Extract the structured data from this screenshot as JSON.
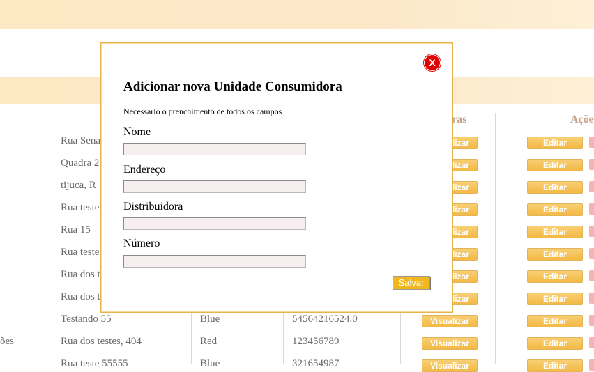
{
  "table": {
    "headers": {
      "col2_partial": "",
      "faturas_partial": "ras",
      "acoes_partial": "Açõe"
    },
    "left_edge_text": "ões",
    "rows": [
      {
        "endereco": "Rua Sena",
        "distribuidora": "",
        "numero": "",
        "visualizar": "Visualizar",
        "editar": "Editar"
      },
      {
        "endereco": "Quadra 2",
        "distribuidora": "",
        "numero": "",
        "visualizar": "Visualizar",
        "editar": "Editar"
      },
      {
        "endereco": "tijuca, R",
        "distribuidora": "",
        "numero": "",
        "visualizar": "Visualizar",
        "editar": "Editar"
      },
      {
        "endereco": "Rua teste",
        "distribuidora": "",
        "numero": "",
        "visualizar": "Visualizar",
        "editar": "Editar"
      },
      {
        "endereco": "Rua 15",
        "distribuidora": "",
        "numero": "",
        "visualizar": "Visualizar",
        "editar": "Editar"
      },
      {
        "endereco": "Rua teste",
        "distribuidora": "",
        "numero": "",
        "visualizar": "Visualizar",
        "editar": "Editar"
      },
      {
        "endereco": "Rua dos t",
        "distribuidora": "",
        "numero": "",
        "visualizar": "Visualizar",
        "editar": "Editar"
      },
      {
        "endereco": "Rua dos t",
        "distribuidora": "",
        "numero": "",
        "visualizar": "Visualizar",
        "editar": "Editar"
      },
      {
        "endereco": "Testando 55",
        "distribuidora": "Blue",
        "numero": "54564216524.0",
        "visualizar": "Visualizar",
        "editar": "Editar"
      },
      {
        "endereco": "Rua dos testes, 404",
        "distribuidora": "Red",
        "numero": "123456789",
        "visualizar": "Visualizar",
        "editar": "Editar"
      },
      {
        "endereco": "Rua teste 55555",
        "distribuidora": "Blue",
        "numero": "321654987",
        "visualizar": "Visualizar",
        "editar": "Editar"
      }
    ]
  },
  "modal": {
    "close_label": "X",
    "title": "Adicionar nova Unidade Consumidora",
    "note": "Necessário o prenchimento de todos os campos",
    "fields": [
      {
        "label": "Nome",
        "value": ""
      },
      {
        "label": "Endereço",
        "value": ""
      },
      {
        "label": "Distribuidora",
        "value": ""
      },
      {
        "label": "Número",
        "value": ""
      }
    ],
    "save_label": "Salvar"
  },
  "colors": {
    "banner": "#fce7c7",
    "button": "#f3b944",
    "close": "#e00000",
    "modal_border": "#e6b44b"
  }
}
